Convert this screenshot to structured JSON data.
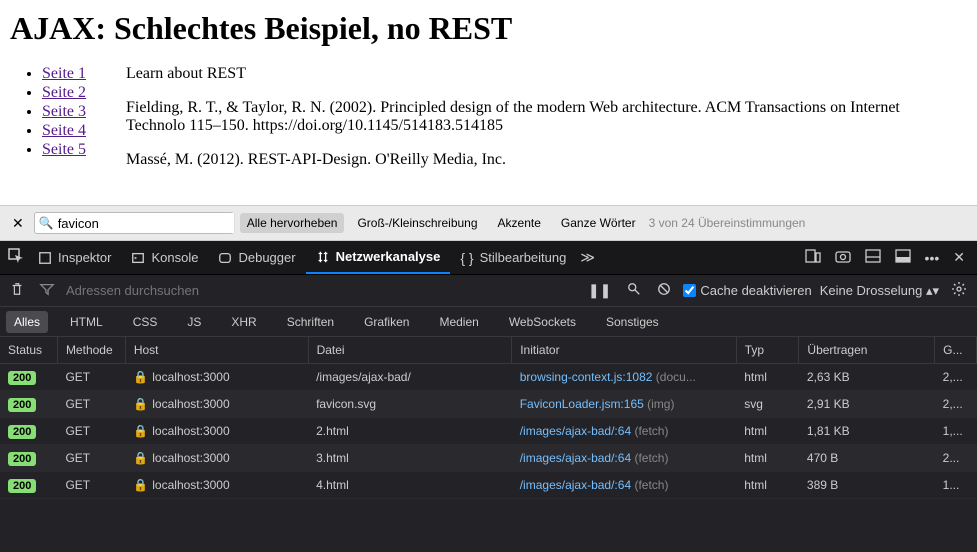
{
  "page": {
    "title": "AJAX: Schlechtes Beispiel, no REST",
    "nav": [
      {
        "label": "Seite 1"
      },
      {
        "label": "Seite 2"
      },
      {
        "label": "Seite 3"
      },
      {
        "label": "Seite 4"
      },
      {
        "label": "Seite 5"
      }
    ],
    "para1": "Learn about REST",
    "para2": "Fielding, R. T., & Taylor, R. N. (2002). Principled design of the modern Web architecture. ACM Transactions on Internet Technolo 115–150. https://doi.org/10.1145/514183.514185",
    "para3": "Massé, M. (2012). REST-API-Design. O'Reilly Media, Inc."
  },
  "find": {
    "query": "favicon",
    "options": {
      "highlight": "Alle hervorheben",
      "case": "Groß-/Kleinschreibung",
      "accents": "Akzente",
      "words": "Ganze Wörter"
    },
    "count": "3 von 24 Übereinstimmungen"
  },
  "devtools": {
    "tabs": {
      "inspector": "Inspektor",
      "console": "Konsole",
      "debugger": "Debugger",
      "network": "Netzwerkanalyse",
      "style": "Stilbearbeitung"
    },
    "net": {
      "filter_placeholder": "Adressen durchsuchen",
      "cache_label": "Cache deaktivieren",
      "throttle": "Keine Drosselung",
      "types": {
        "all": "Alles",
        "html": "HTML",
        "css": "CSS",
        "js": "JS",
        "xhr": "XHR",
        "fonts": "Schriften",
        "images": "Grafiken",
        "media": "Medien",
        "ws": "WebSockets",
        "other": "Sonstiges"
      },
      "headers": {
        "status": "Status",
        "method": "Methode",
        "host": "Host",
        "file": "Datei",
        "initiator": "Initiator",
        "type": "Typ",
        "transferred": "Übertragen",
        "size": "G..."
      },
      "rows": [
        {
          "status": "200",
          "method": "GET",
          "host": "localhost:3000",
          "file": "/images/ajax-bad/",
          "initiator": "browsing-context.js:1082",
          "initiator_extra": " (docu...",
          "type": "html",
          "transferred": "2,63 KB",
          "size": "2,..."
        },
        {
          "status": "200",
          "method": "GET",
          "host": "localhost:3000",
          "file": "favicon.svg",
          "initiator": "FaviconLoader.jsm:165",
          "initiator_extra": " (img)",
          "type": "svg",
          "transferred": "2,91 KB",
          "size": "2,..."
        },
        {
          "status": "200",
          "method": "GET",
          "host": "localhost:3000",
          "file": "2.html",
          "initiator": "/images/ajax-bad/:64",
          "initiator_extra": " (fetch)",
          "type": "html",
          "transferred": "1,81 KB",
          "size": "1,..."
        },
        {
          "status": "200",
          "method": "GET",
          "host": "localhost:3000",
          "file": "3.html",
          "initiator": "/images/ajax-bad/:64",
          "initiator_extra": " (fetch)",
          "type": "html",
          "transferred": "470 B",
          "size": "2..."
        },
        {
          "status": "200",
          "method": "GET",
          "host": "localhost:3000",
          "file": "4.html",
          "initiator": "/images/ajax-bad/:64",
          "initiator_extra": " (fetch)",
          "type": "html",
          "transferred": "389 B",
          "size": "1..."
        }
      ]
    }
  }
}
